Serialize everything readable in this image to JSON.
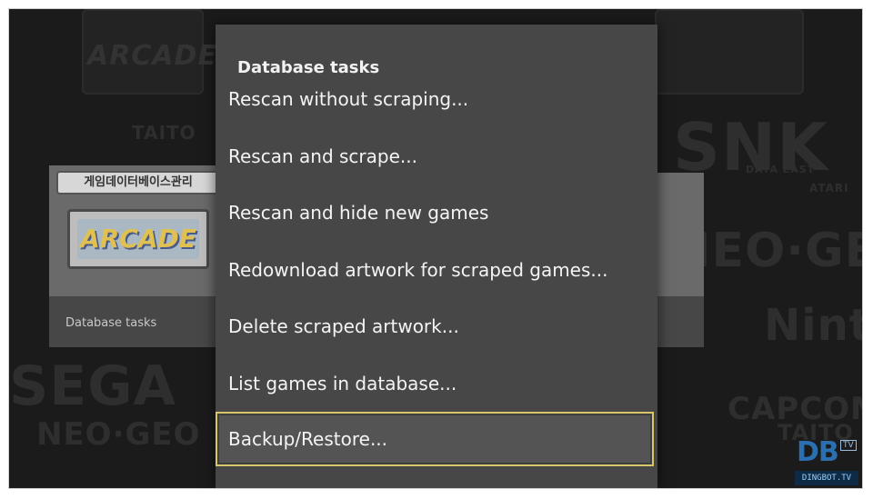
{
  "dialog": {
    "title": "Database tasks",
    "items": [
      {
        "label": "Rescan without scraping..."
      },
      {
        "label": "Rescan and scrape..."
      },
      {
        "label": "Rescan and hide new games"
      },
      {
        "label": "Redownload artwork for scraped games..."
      },
      {
        "label": "Delete scraped artwork..."
      },
      {
        "label": "List games in database..."
      },
      {
        "label": "Backup/Restore...",
        "selected": true
      }
    ]
  },
  "background_card": {
    "marquee": "게임데이터베이스관리",
    "screen_text": "ARCADE",
    "label": "Database tasks"
  },
  "background_brands": [
    "ARCADE",
    "SNK",
    "TAITO",
    "NEO·GEO",
    "DATA EAST",
    "Nintendo",
    "SEGA",
    "CAPCOM",
    "ATARI"
  ],
  "watermark": {
    "logo": "DB",
    "tag": "TV",
    "site": "DINGBOT.TV"
  },
  "colors": {
    "dialog_bg": "#474747",
    "selection_border": "#d7c66a",
    "background": "#1b1b1b"
  }
}
